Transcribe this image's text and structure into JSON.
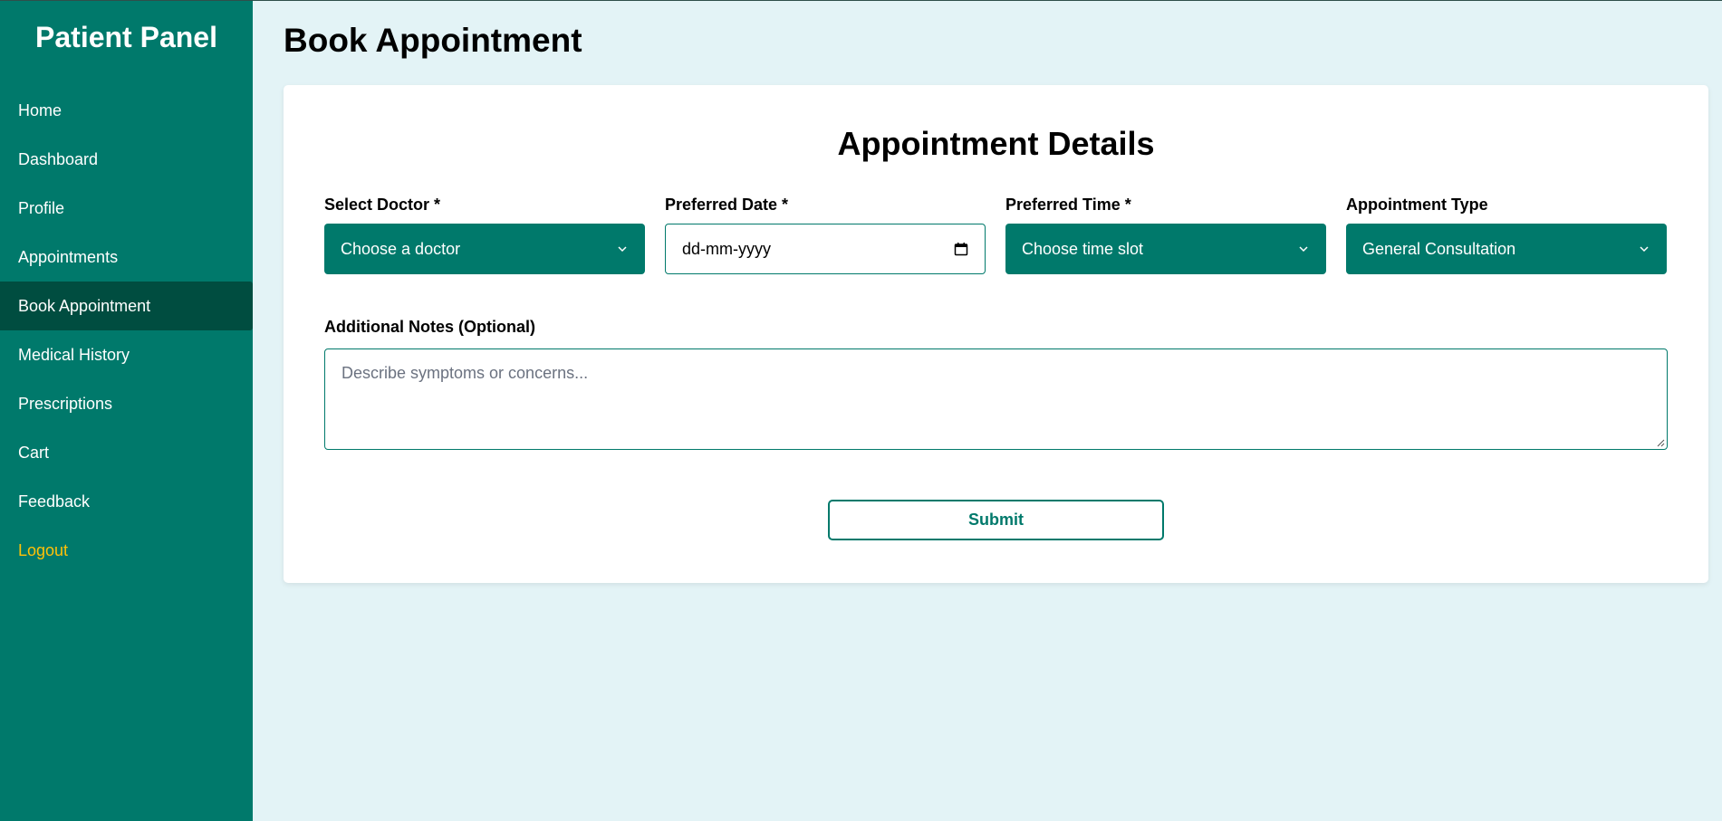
{
  "sidebar": {
    "brand": "Patient Panel",
    "items": [
      {
        "label": "Home"
      },
      {
        "label": "Dashboard"
      },
      {
        "label": "Profile"
      },
      {
        "label": "Appointments"
      },
      {
        "label": "Book Appointment"
      },
      {
        "label": "Medical History"
      },
      {
        "label": "Prescriptions"
      },
      {
        "label": "Cart"
      },
      {
        "label": "Feedback"
      },
      {
        "label": "Logout"
      }
    ],
    "active_index": 4
  },
  "main": {
    "page_title": "Book Appointment",
    "card_title": "Appointment Details",
    "fields": {
      "doctor": {
        "label": "Select Doctor *",
        "value": "Choose a doctor"
      },
      "date": {
        "label": "Preferred Date *",
        "value": "dd-mm-yyyy"
      },
      "time": {
        "label": "Preferred Time *",
        "value": "Choose time slot"
      },
      "type": {
        "label": "Appointment Type",
        "value": "General Consultation"
      }
    },
    "notes": {
      "label": "Additional Notes (Optional)",
      "placeholder": "Describe symptoms or concerns..."
    },
    "submit_label": "Submit"
  },
  "colors": {
    "sidebar_bg": "#00796b",
    "active_bg": "#004d40",
    "logout": "#ffc107",
    "page_bg": "#e3f3f6"
  }
}
